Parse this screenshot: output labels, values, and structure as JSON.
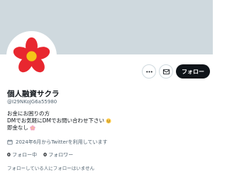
{
  "profile": {
    "display_name": "個人融資サクラ",
    "handle": "@I29NKoJG6a55980",
    "bio_lines": [
      "お金にお困りの方",
      "DMでお気軽にDMでお問い合わせ下さい",
      "即金なし"
    ],
    "bio_emojis": [
      "smiling-face-emoji",
      "pink-flower-emoji"
    ],
    "joined": "2024年6月からTwitterを利用しています",
    "following_count": "0",
    "following_label": "フォロー中",
    "followers_count": "0",
    "followers_label": "フォロワー",
    "followed_by_notice": "フォローしている人にフォローはいません",
    "avatar_icon": "red-flower-icon"
  },
  "actions": {
    "more_icon": "more-horizontal-icon",
    "dm_icon": "mail-icon",
    "follow_label": "フォロー"
  },
  "colors": {
    "banner": "#cfd9de",
    "follow_button": "#0f1419",
    "secondary_text": "#536471",
    "flower_petal": "#e8272f",
    "flower_center": "#f5c518"
  }
}
